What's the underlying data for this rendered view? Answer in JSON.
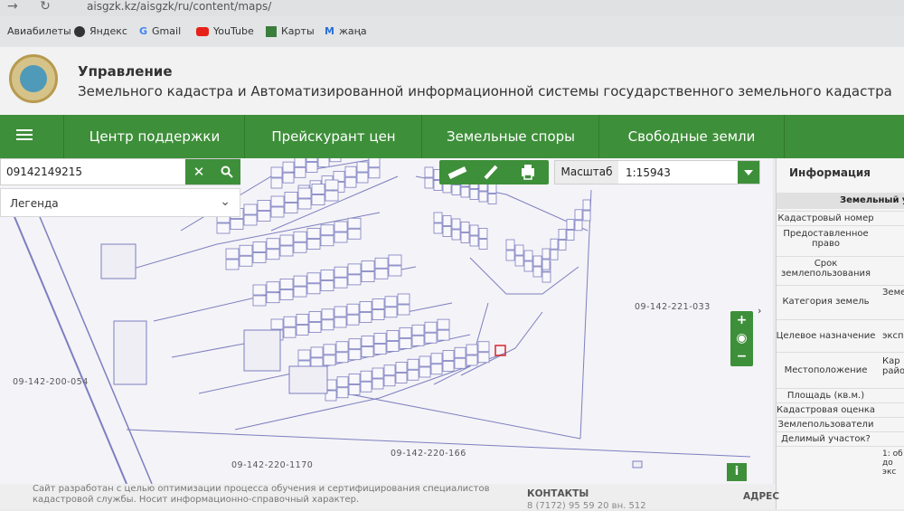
{
  "browser": {
    "url": "aisgzk.kz/aisgzk/ru/content/maps/",
    "bookmarks": [
      {
        "label": "Авиабилеты",
        "icon": "none"
      },
      {
        "label": "Яндекс",
        "icon": "globe-icon",
        "color": "#333333"
      },
      {
        "label": "Gmail",
        "icon": "google-icon",
        "color": "#4285f4"
      },
      {
        "label": "YouTube",
        "icon": "youtube-icon",
        "color": "#e62117"
      },
      {
        "label": "Карты",
        "icon": "maps-icon",
        "color": "#3b7d3b"
      },
      {
        "label": "жаңа",
        "icon": "m-icon",
        "color": "#2a6fd6"
      }
    ]
  },
  "header": {
    "title_line1": "Управление",
    "title_line2": "Земельного кадастра и Автоматизированной информационной системы государственного земельного кадастра"
  },
  "nav": {
    "items": [
      "Центр поддержки",
      "Прейскурант цен",
      "Земельные споры",
      "Свободные земли"
    ]
  },
  "search": {
    "value": "09142149215"
  },
  "legend": {
    "label": "Легенда"
  },
  "scale": {
    "label": "Масштаб",
    "value": "1:15943"
  },
  "map": {
    "labels": [
      "09-142-221-033",
      "09-142-200-054",
      "09-142-220-166",
      "09-142-220-1170"
    ]
  },
  "info": {
    "title": "Информация",
    "section": "Земельный уч",
    "rows": [
      {
        "key": "Кадастровый номер",
        "value": ""
      },
      {
        "key": "Предоставленное право",
        "value": ""
      },
      {
        "key": "Срок землепользования",
        "value": ""
      },
      {
        "key": "Категория земель",
        "value": "Земе"
      },
      {
        "key": "Целевое назначение",
        "value": "экспл"
      },
      {
        "key": "Местоположение",
        "value": "Кар райо"
      },
      {
        "key": "Площадь (кв.м.)",
        "value": ""
      },
      {
        "key": "Кадастровая оценка",
        "value": ""
      },
      {
        "key": "Землепользователи",
        "value": ""
      },
      {
        "key": "Делимый участок?",
        "value": ""
      }
    ],
    "extra": "1: об до экс"
  },
  "footer": {
    "text": "Сайт разработан с целью оптимизации процесса обучения и сертифицирования специалистов кадастровой службы. Носит информационно-справочный характер.",
    "contacts": "КОНТАКТЫ",
    "phone": "8 (7172) 95 59 20 вн. 512",
    "address": "АДРЕС"
  },
  "colors": {
    "accent": "#3e8f3a",
    "parcel_line": "#7d7fc0",
    "selected_parcel": "#d8262c"
  }
}
